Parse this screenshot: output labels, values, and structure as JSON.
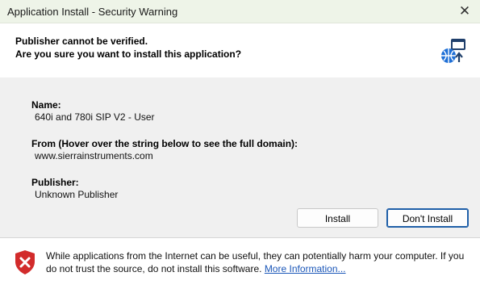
{
  "window": {
    "title": "Application Install - Security Warning",
    "close_glyph": "✕"
  },
  "header": {
    "line1": "Publisher cannot be verified.",
    "line2": "Are you sure you want to install this application?",
    "icon": "globe-app-install-icon"
  },
  "details": {
    "name_label": "Name:",
    "name_value": "640i and 780i SIP V2 - User",
    "from_label": "From (Hover over the string below to see the full domain):",
    "from_value": "www.sierrainstruments.com",
    "publisher_label": "Publisher:",
    "publisher_value": "Unknown Publisher"
  },
  "buttons": {
    "install": "Install",
    "dont_install": "Don't Install"
  },
  "footer": {
    "warning": "While applications from the Internet can be useful, they can potentially harm your computer. If you do not trust the source, do not install this software. ",
    "link": "More Information...",
    "icon": "shield-x-icon"
  },
  "colors": {
    "titlebar_bg": "#eef4e8",
    "content_bg": "#f0f0f0",
    "link": "#1a56b8",
    "shield_red": "#d22b2b",
    "default_button_border": "#1f5fa8"
  }
}
